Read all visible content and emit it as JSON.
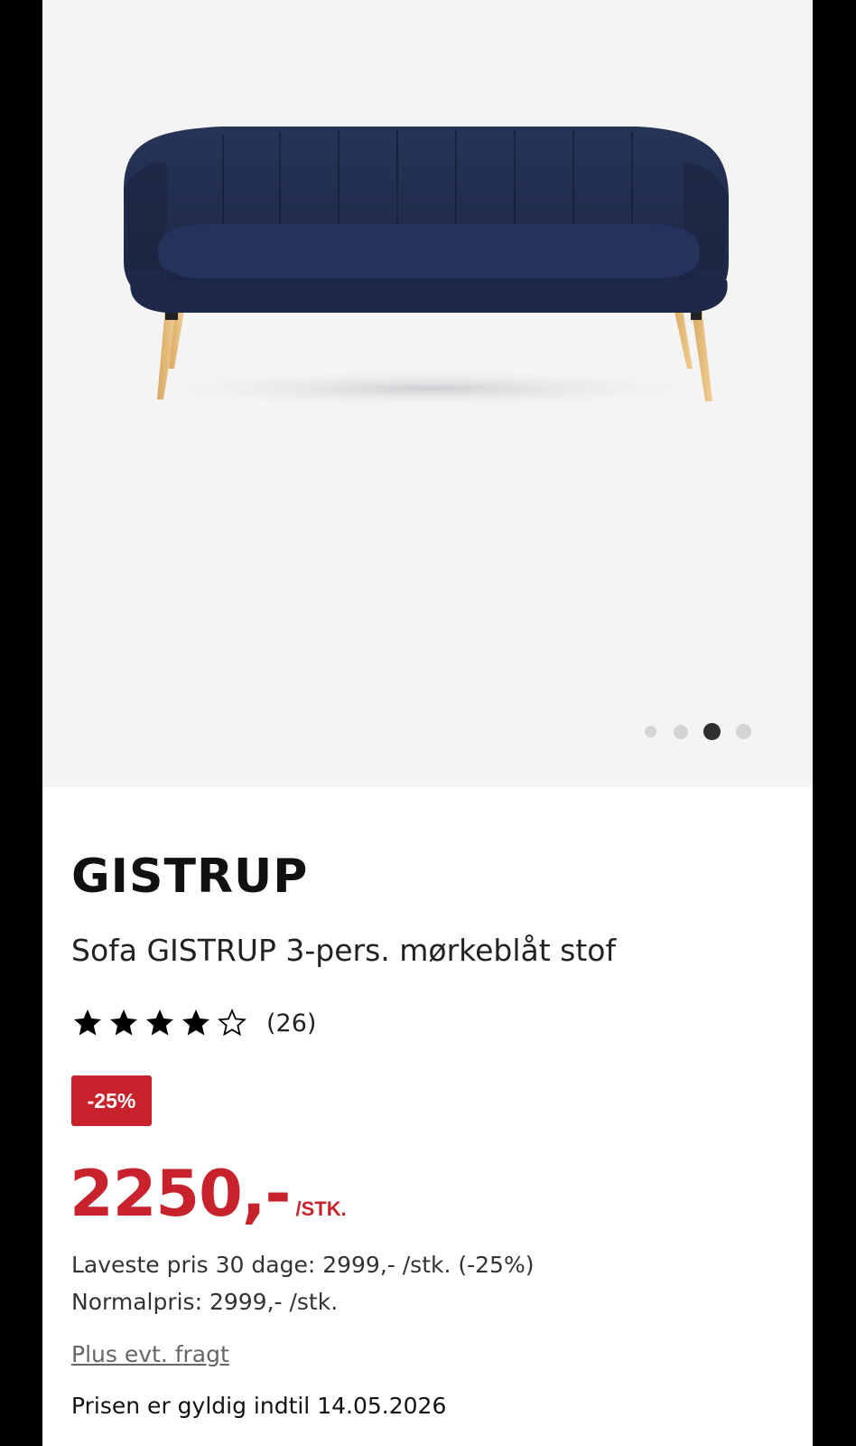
{
  "product": {
    "brand": "GISTRUP",
    "title": "Sofa GISTRUP 3-pers. mørkeblåt stof",
    "rating": 4,
    "rating_max": 5,
    "review_count": "(26)",
    "discount_badge": "-25%",
    "price": "2250,-",
    "price_unit": "/STK.",
    "lowest_price": "Laveste pris 30 dage: 2999,- /stk. (-25%)",
    "normal_price": "Normalpris: 2999,- /stk.",
    "freight_link": "Plus evt. fragt",
    "valid_until": "Prisen er gyldig indtil 14.05.2026"
  },
  "gallery": {
    "image": "navy-sofa-with-wooden-legs",
    "image_count": 4,
    "active_index": 2
  },
  "colors": {
    "accent_red": "#c8232c",
    "sofa_navy": "#1f2a4a",
    "gallery_bg": "#f4f4f5"
  }
}
